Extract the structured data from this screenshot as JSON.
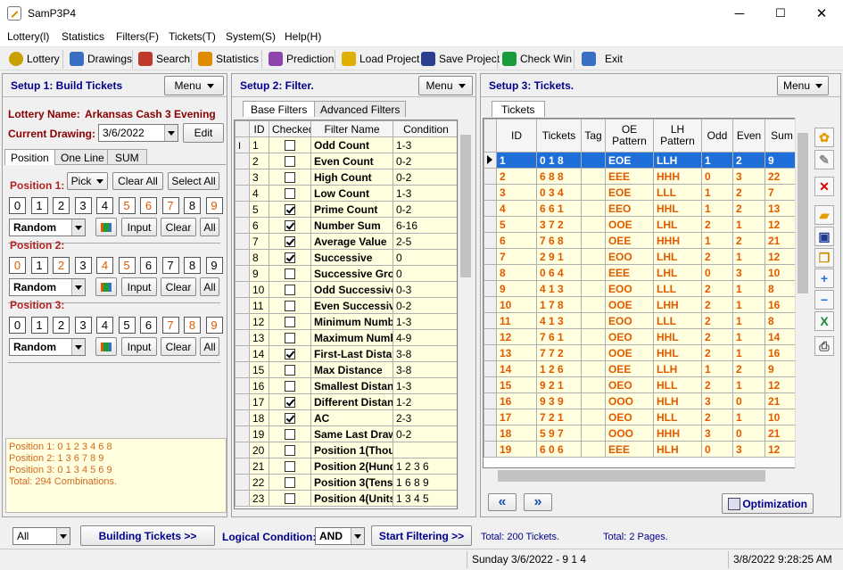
{
  "window": {
    "title": "SamP3P4",
    "minimize": "─",
    "maximize": "☐",
    "close": "✕"
  },
  "menu": [
    "Lottery(l)",
    "Statistics",
    "Filters(F)",
    "Tickets(T)",
    "System(S)",
    "Help(H)"
  ],
  "toolbar": [
    {
      "label": "Lottery",
      "icon": "lottery-balls-icon",
      "color": "#c8a000"
    },
    {
      "label": "Drawings",
      "icon": "drawings-icon",
      "color": "#3a6fc4"
    },
    {
      "label": "Search",
      "icon": "search-icon",
      "color": "#c0392b"
    },
    {
      "label": "Statistics",
      "icon": "statistics-icon",
      "color": "#e08a00"
    },
    {
      "label": "Prediction",
      "icon": "prediction-icon",
      "color": "#8e44ad"
    },
    {
      "label": "Load Project",
      "icon": "folder-open-icon",
      "color": "#e0b000"
    },
    {
      "label": "Save Project",
      "icon": "save-icon",
      "color": "#2c3e8f"
    },
    {
      "label": "Check Win",
      "icon": "checkmark-icon",
      "color": "#1a9c3c"
    },
    {
      "label": "Exit",
      "icon": "exit-icon",
      "color": "#3a6fc4"
    }
  ],
  "setup1": {
    "title": "Setup 1: Build  Tickets",
    "menu": "Menu",
    "lottery_label": "Lottery  Name:",
    "lottery_name": "Arkansas Cash 3 Evening",
    "drawing_label": "Current Drawing:",
    "drawing_value": "3/6/2022",
    "edit": "Edit",
    "tabs": [
      "Position",
      "One Line",
      "SUM"
    ],
    "pick": "Pick",
    "clear_all": "Clear All",
    "select_all": "Select All",
    "positions": [
      {
        "label": "Position 1:",
        "selected": [
          5,
          6,
          7,
          9
        ],
        "mode": "Random"
      },
      {
        "label": "Position 2:",
        "selected": [
          0,
          2,
          4,
          5
        ],
        "mode": "Random"
      },
      {
        "label": "Position 3:",
        "selected": [
          7,
          8,
          9
        ],
        "mode": "Random"
      }
    ],
    "digits": [
      "0",
      "1",
      "2",
      "3",
      "4",
      "5",
      "6",
      "7",
      "8",
      "9"
    ],
    "input": "Input",
    "clear": "Clear",
    "all": "All",
    "summary": [
      "Position 1:  0 1 2 3 4 6 8",
      "Position 2:  1 3 6 7 8 9",
      "Position 3:  0 1 3 4 5 6 9",
      "Total: 294 Combinations."
    ]
  },
  "setup2": {
    "title": "Setup 2: Filter.",
    "menu": "Menu",
    "tabs": [
      "Base Filters",
      "Advanced Filters"
    ],
    "headers": [
      "ID",
      "Checked",
      "Filter Name",
      "Condition"
    ],
    "rows": [
      {
        "id": "1",
        "checked": false,
        "name": "Odd Count",
        "cond": "1-3"
      },
      {
        "id": "2",
        "checked": false,
        "name": "Even Count",
        "cond": "0-2"
      },
      {
        "id": "3",
        "checked": false,
        "name": "High Count",
        "cond": "0-2"
      },
      {
        "id": "4",
        "checked": false,
        "name": "Low Count",
        "cond": "1-3"
      },
      {
        "id": "5",
        "checked": true,
        "name": "Prime Count",
        "cond": "0-2"
      },
      {
        "id": "6",
        "checked": true,
        "name": "Number Sum",
        "cond": "6-16"
      },
      {
        "id": "7",
        "checked": true,
        "name": "Average Value",
        "cond": "2-5"
      },
      {
        "id": "8",
        "checked": true,
        "name": "Successive",
        "cond": "0"
      },
      {
        "id": "9",
        "checked": false,
        "name": "Successive Grou",
        "cond": "0"
      },
      {
        "id": "10",
        "checked": false,
        "name": "Odd Successive",
        "cond": "0-3"
      },
      {
        "id": "11",
        "checked": false,
        "name": "Even Successive",
        "cond": "0-2"
      },
      {
        "id": "12",
        "checked": false,
        "name": "Minimum Numbe",
        "cond": "1-3"
      },
      {
        "id": "13",
        "checked": false,
        "name": "Maximum Numbe",
        "cond": "4-9"
      },
      {
        "id": "14",
        "checked": true,
        "name": "First-Last Distan",
        "cond": "3-8"
      },
      {
        "id": "15",
        "checked": false,
        "name": "Max Distance",
        "cond": "3-8"
      },
      {
        "id": "16",
        "checked": false,
        "name": "Smallest Distanc",
        "cond": "1-3"
      },
      {
        "id": "17",
        "checked": true,
        "name": "Different Distan",
        "cond": "1-2"
      },
      {
        "id": "18",
        "checked": true,
        "name": "AC",
        "cond": "2-3"
      },
      {
        "id": "19",
        "checked": false,
        "name": "Same Last Draw",
        "cond": "0-2"
      },
      {
        "id": "20",
        "checked": false,
        "name": "Position 1(Thous",
        "cond": ""
      },
      {
        "id": "21",
        "checked": false,
        "name": "Position 2(Hund",
        "cond": "1 2 3 6"
      },
      {
        "id": "22",
        "checked": false,
        "name": "Position 3(Tens)",
        "cond": "1 6 8 9"
      },
      {
        "id": "23",
        "checked": false,
        "name": "Position 4(Units",
        "cond": "1 3 4 5"
      }
    ]
  },
  "setup3": {
    "title": "Setup 3: Tickets.",
    "menu": "Menu",
    "tab": "Tickets",
    "headers": [
      "ID",
      "Tickets",
      "Tag",
      "OE Pattern",
      "LH Pattern",
      "Odd",
      "Even",
      "Sum"
    ],
    "rows": [
      [
        "1",
        "0 1 8",
        "",
        "EOE",
        "LLH",
        "1",
        "2",
        "9"
      ],
      [
        "2",
        "6 8 8",
        "",
        "EEE",
        "HHH",
        "0",
        "3",
        "22"
      ],
      [
        "3",
        "0 3 4",
        "",
        "EOE",
        "LLL",
        "1",
        "2",
        "7"
      ],
      [
        "4",
        "6 6 1",
        "",
        "EEO",
        "HHL",
        "1",
        "2",
        "13"
      ],
      [
        "5",
        "3 7 2",
        "",
        "OOE",
        "LHL",
        "2",
        "1",
        "12"
      ],
      [
        "6",
        "7 6 8",
        "",
        "OEE",
        "HHH",
        "1",
        "2",
        "21"
      ],
      [
        "7",
        "2 9 1",
        "",
        "EOO",
        "LHL",
        "2",
        "1",
        "12"
      ],
      [
        "8",
        "0 6 4",
        "",
        "EEE",
        "LHL",
        "0",
        "3",
        "10"
      ],
      [
        "9",
        "4 1 3",
        "",
        "EOO",
        "LLL",
        "2",
        "1",
        "8"
      ],
      [
        "10",
        "1 7 8",
        "",
        "OOE",
        "LHH",
        "2",
        "1",
        "16"
      ],
      [
        "11",
        "4 1 3",
        "",
        "EOO",
        "LLL",
        "2",
        "1",
        "8"
      ],
      [
        "12",
        "7 6 1",
        "",
        "OEO",
        "HHL",
        "2",
        "1",
        "14"
      ],
      [
        "13",
        "7 7 2",
        "",
        "OOE",
        "HHL",
        "2",
        "1",
        "16"
      ],
      [
        "14",
        "1 2 6",
        "",
        "OEE",
        "LLH",
        "1",
        "2",
        "9"
      ],
      [
        "15",
        "9 2 1",
        "",
        "OEO",
        "HLL",
        "2",
        "1",
        "12"
      ],
      [
        "16",
        "9 3 9",
        "",
        "OOO",
        "HLH",
        "3",
        "0",
        "21"
      ],
      [
        "17",
        "7 2 1",
        "",
        "OEO",
        "HLL",
        "2",
        "1",
        "10"
      ],
      [
        "18",
        "5 9 7",
        "",
        "OOO",
        "HHH",
        "3",
        "0",
        "21"
      ],
      [
        "19",
        "6 0 6",
        "",
        "EEE",
        "HLH",
        "0",
        "3",
        "12"
      ]
    ],
    "optimization": "Optimization",
    "side_icons": [
      "paint-icon",
      "brush-icon",
      "delete-icon",
      "folder-icon",
      "save-icon",
      "copy-icon",
      "plus-icon",
      "minus-icon",
      "excel-icon",
      "print-icon"
    ]
  },
  "bottom": {
    "scope": "All",
    "build": "Building  Tickets >>",
    "logic_label": "Logical Condition:",
    "logic_value": "AND",
    "start": "Start Filtering  >>",
    "total_tickets": "Total: 200 Tickets.",
    "total_pages": "Total: 2 Pages."
  },
  "status": {
    "draw": "Sunday 3/6/2022 - 9 1 4",
    "datetime": "3/8/2022 9:28:25 AM"
  }
}
